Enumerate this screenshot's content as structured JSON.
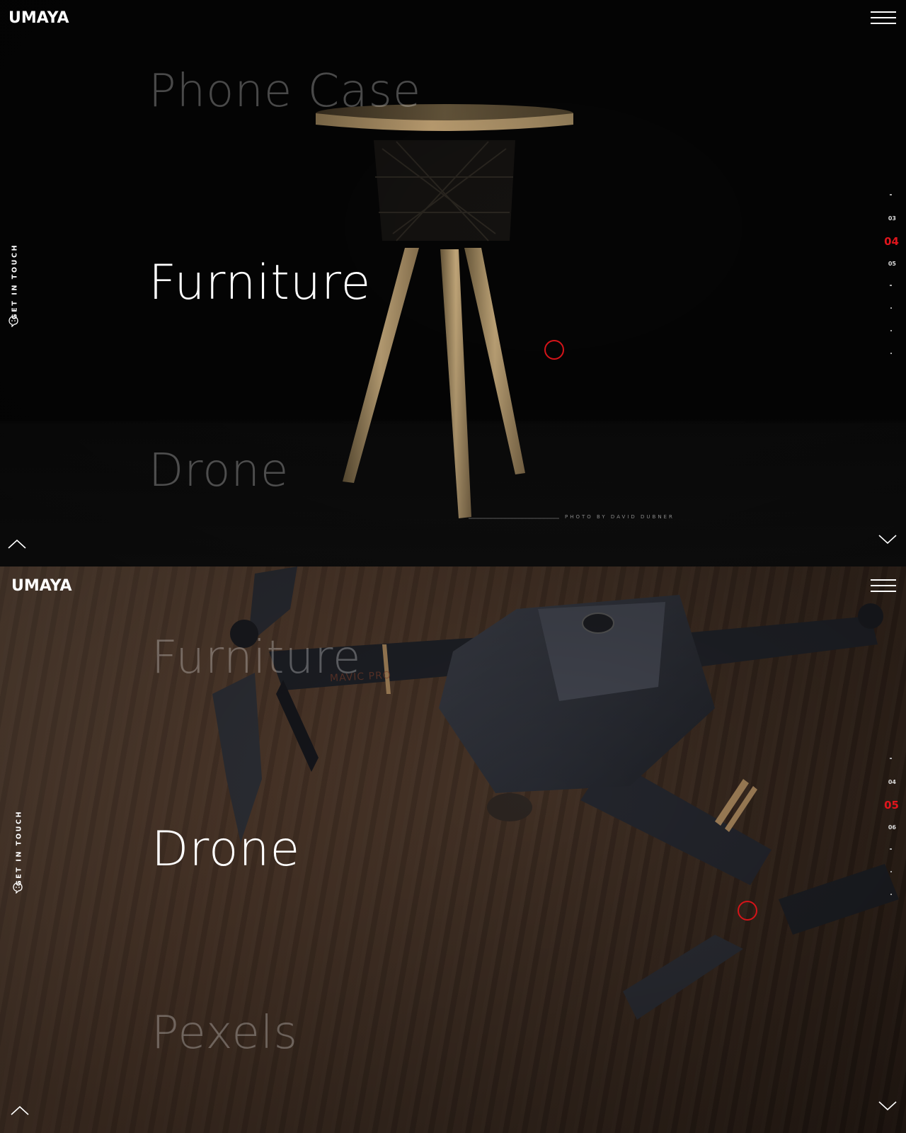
{
  "brand": {
    "name": "UMAYA"
  },
  "panel1": {
    "prev_title": "Phone Case",
    "current_title": "Furniture",
    "next_title": "Drone",
    "get_in_touch": "GET IN TOUCH",
    "pager": {
      "before": "03",
      "current": "04",
      "after": "05"
    },
    "credit": "PHOTO BY DAVID DUBNER"
  },
  "panel2": {
    "prev_title": "Furniture",
    "current_title": "Drone",
    "next_title": "Pexels",
    "get_in_touch": "GET IN TOUCH",
    "pager": {
      "before": "04",
      "current": "05",
      "after": "06"
    },
    "drone_model_text": "MAVIC PRO"
  },
  "colors": {
    "accent": "#e0151c",
    "dark_bg": "#050505",
    "wood": "#4a3528"
  },
  "icons": {
    "menu": "hamburger-icon",
    "up": "chevron-up-icon",
    "down": "chevron-down-icon",
    "contact": "chat-bubble-icon"
  }
}
